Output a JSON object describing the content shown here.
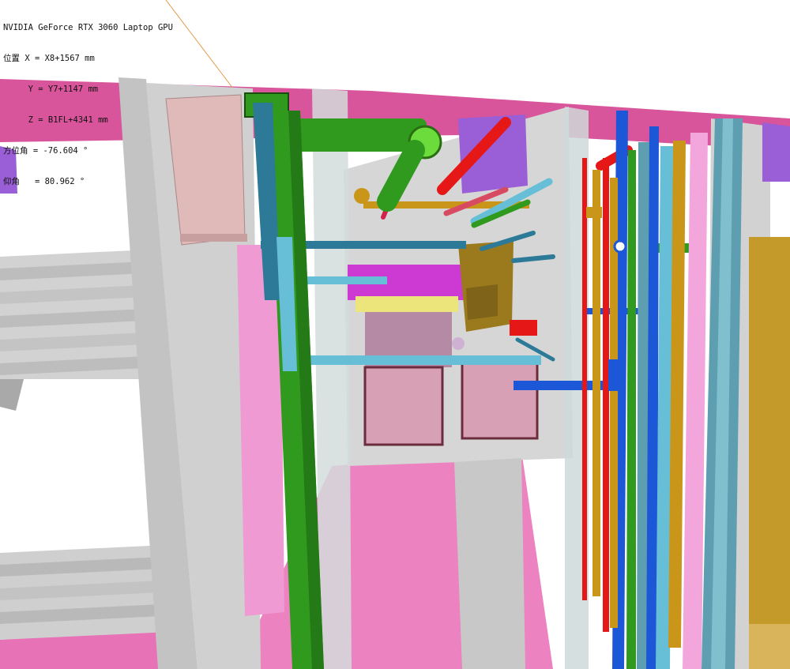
{
  "hud": {
    "gpu": "NVIDIA GeForce RTX 3060 Laptop GPU",
    "position_x": "位置 X = X8+1567 mm",
    "position_y": "     Y = Y7+1147 mm",
    "position_z": "     Z = B1FL+4341 mm",
    "azimuth": "方位角 = -76.604 °",
    "elevation": "仰角   = 80.962 °"
  },
  "colors": {
    "background": "#ffffff",
    "ceiling_slab": "#d9559b",
    "floor": "#ec82c0",
    "wall_gray": "#c9c9c9",
    "wall_translucent": "#d4dcdc",
    "steel_beam": "#9a5ed6",
    "pipe_green": "#2f9a1d",
    "pipe_blue": "#1c57d8",
    "pipe_cyan": "#66bfd6",
    "pipe_dark_cyan": "#2c7a97",
    "pipe_red": "#e61717",
    "pipe_yellow": "#c9961a",
    "pipe_pink": "#f3a6dc",
    "pipe_teal": "#5d9fb0",
    "duct_pink": "#d8a0b4",
    "equipment_brown": "#9b7a1e",
    "equipment_magenta": "#cc3ad3",
    "cable_tray_yellow": "#ece57c",
    "mesh_right": "#c49a2a"
  }
}
